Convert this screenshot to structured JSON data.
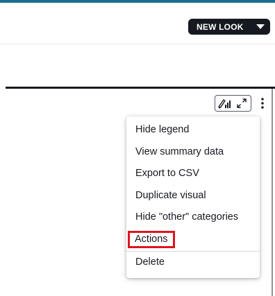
{
  "header": {
    "new_look_label": "NEW LOOK",
    "accent_color": "#1a6f8f"
  },
  "visual_toolbar": {
    "icons": [
      "format-visual-icon",
      "expand-icon",
      "more-options-icon"
    ]
  },
  "menu": {
    "items": [
      {
        "label": "Hide legend"
      },
      {
        "label": "View summary data"
      },
      {
        "label": "Export to CSV"
      },
      {
        "label": "Duplicate visual"
      },
      {
        "label": "Hide \"other\" categories"
      },
      {
        "label": "Actions",
        "highlighted": true
      },
      {
        "label": "Delete"
      }
    ],
    "highlight_color": "#e0131f"
  }
}
